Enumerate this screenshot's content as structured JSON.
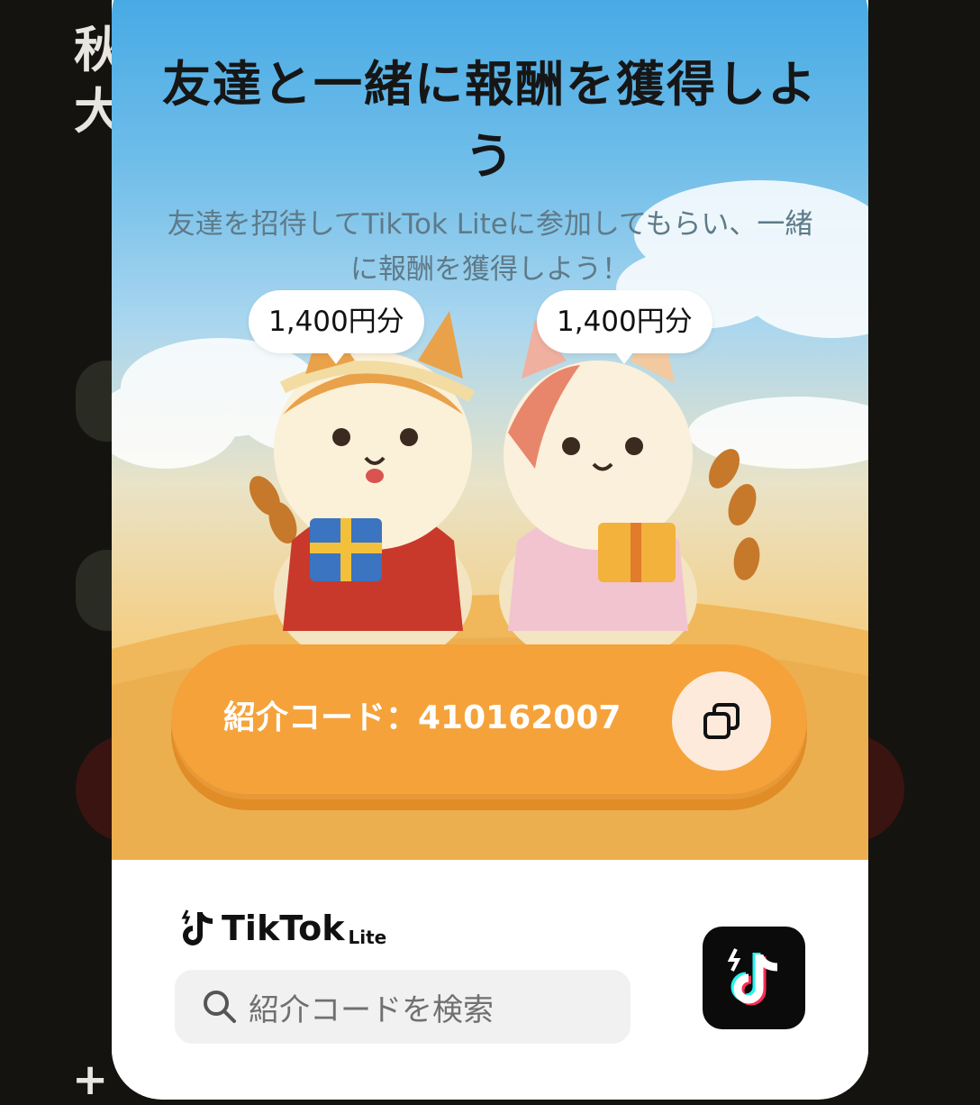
{
  "background": {
    "title_partial": "秋大",
    "bottom_partial": "+"
  },
  "modal": {
    "headline": "友達と一緒に報酬を獲得しよう",
    "subtitle": "友達を招待してTikTok Liteに参加してもらい、一緒に報酬を獲得しよう！",
    "reward_left": "1,400円分",
    "reward_right": "1,400円分",
    "referral_code_label": "紹介コード：410162007",
    "copy_icon": "copy-icon"
  },
  "footer": {
    "brand_name": "TikTok",
    "brand_suffix": "Lite",
    "search_placeholder": "紹介コードを検索",
    "search_icon": "search-icon",
    "app_icon": "tiktok-lite-app-icon"
  },
  "colors": {
    "accent_orange": "#f5a23a",
    "sky_blue": "#3fa6e4",
    "copy_button_bg": "#fdeadb"
  }
}
